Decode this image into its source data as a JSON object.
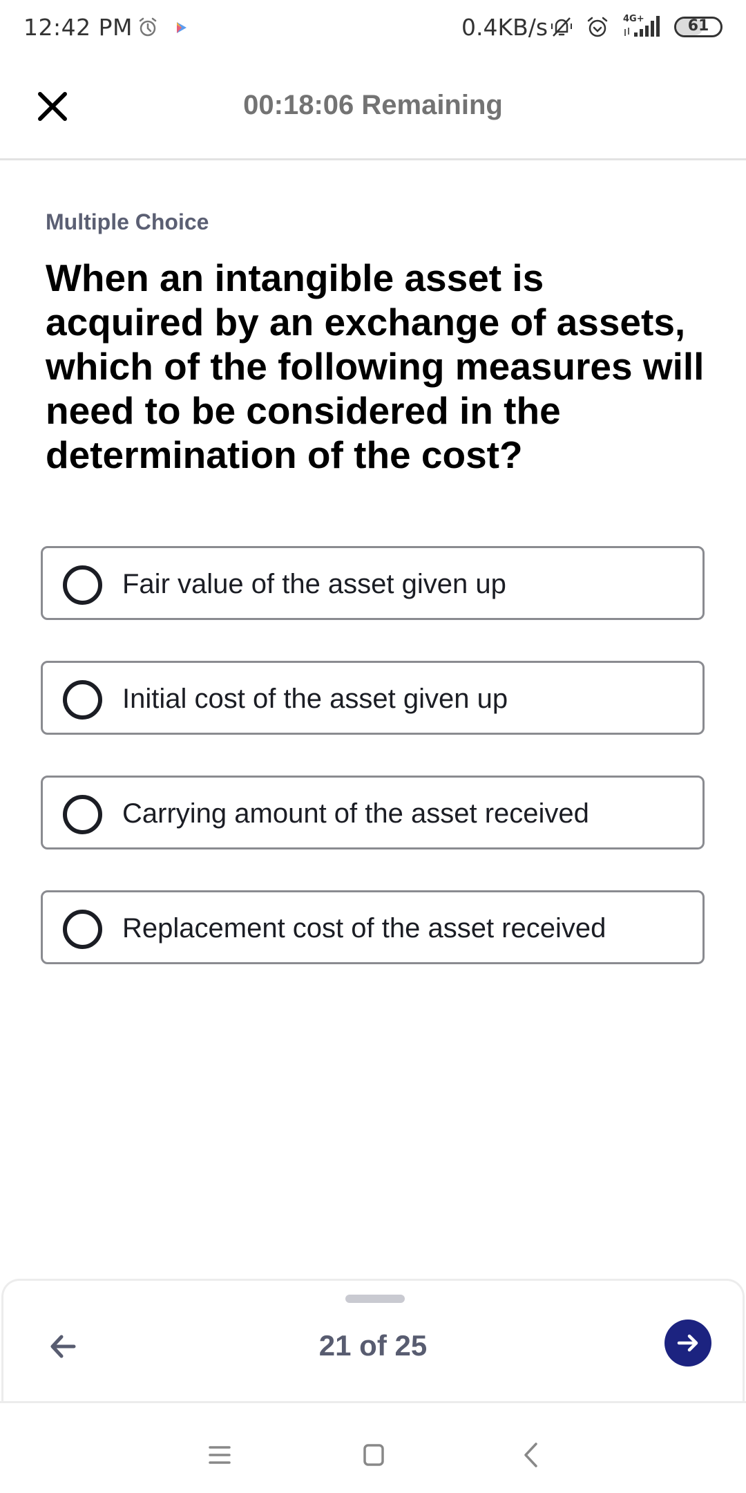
{
  "status_bar": {
    "time": "12:42 PM",
    "network_speed": "0.4KB/s",
    "network_type": "4G+",
    "battery_level": "61",
    "battery_fraction": 0.61,
    "icons": [
      "alarm-icon",
      "play-store-icon",
      "mute-icon",
      "alarm-icon",
      "signal-icon",
      "battery-icon"
    ]
  },
  "header": {
    "close_icon": "close-icon",
    "timer": "00:18:06 Remaining"
  },
  "question": {
    "type_label": "Multiple Choice",
    "text": "When an intangible asset is acquired by an exchange of assets, which of the following measures will need to be considered in the determination of the cost?",
    "options": [
      {
        "label": "Fair value of the asset given up",
        "selected": false
      },
      {
        "label": "Initial cost of the asset given up",
        "selected": false
      },
      {
        "label": "Carrying amount of the asset received",
        "selected": false
      },
      {
        "label": "Replacement cost of the asset received",
        "selected": false
      }
    ]
  },
  "footer": {
    "current": 21,
    "total": 25,
    "page_counter": "21 of 25",
    "prev_icon": "arrow-left-icon",
    "next_icon": "arrow-right-icon",
    "accent_color": "#1c2380"
  },
  "system_nav": {
    "icons": [
      "menu-icon",
      "home-icon",
      "back-icon"
    ]
  }
}
